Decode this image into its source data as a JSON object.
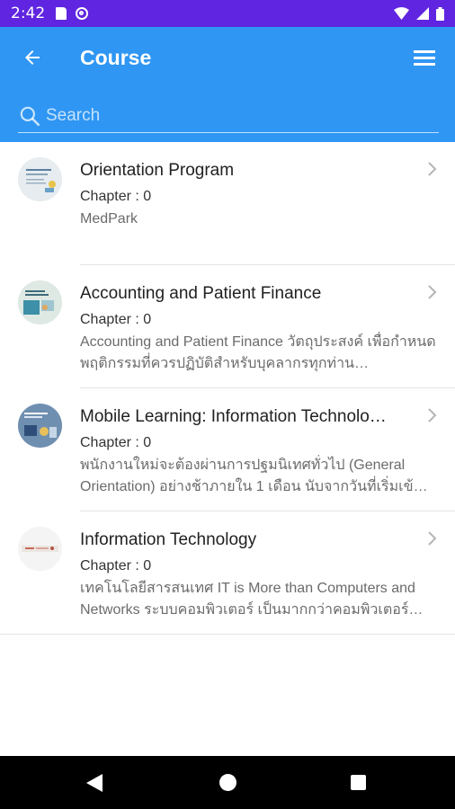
{
  "status_bar": {
    "time": "2:42"
  },
  "header": {
    "title": "Course"
  },
  "search": {
    "placeholder": "Search",
    "value": ""
  },
  "courses": [
    {
      "title": "Orientation Program",
      "chapter": "Chapter : 0",
      "description": "MedPark"
    },
    {
      "title": "Accounting and Patient Finance",
      "chapter": "Chapter : 0",
      "description": "Accounting and Patient Finance วัตถุประสงค์ เพื่อกำหนดพฤติกรรมที่ควรปฏิบัติสำหรับบุคลากรทุกท่าน…"
    },
    {
      "title": "Mobile Learning: Information Technolo…",
      "chapter": "Chapter : 0",
      "description": "พนักงานใหม่จะต้องผ่านการปฐมนิเทศทั่วไป (General Orientation) อย่างช้าภายใน 1 เดือน นับจากวันที่เริ่มเข้…"
    },
    {
      "title": "Information Technology",
      "chapter": "Chapter : 0",
      "description": "เทคโนโลยีสารสนเทศ IT is More than Computers and Networks ระบบคอมพิวเตอร์ เป็นมากกว่าคอมพิวเตอร์…"
    }
  ],
  "colors": {
    "status_bar": "#5f25e0",
    "app_bar": "#2f96f3",
    "nav_bar": "#000000"
  },
  "icons": {
    "back": "arrow-left",
    "menu": "hamburger",
    "search": "magnifier",
    "chevron": "chevron-right"
  }
}
